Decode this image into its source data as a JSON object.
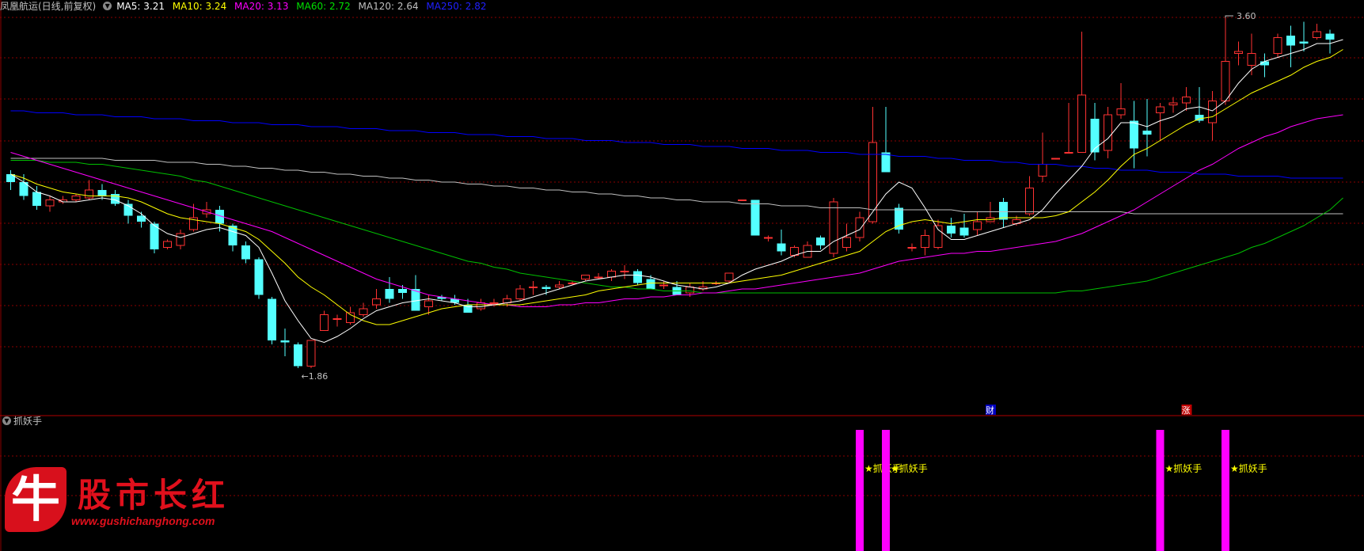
{
  "header": {
    "stock_name": "凤凰航运(日线,前复权)",
    "ma": [
      {
        "label": "MA5: 3.21",
        "color": "#ffffff"
      },
      {
        "label": "MA10: 3.24",
        "color": "#ffff00"
      },
      {
        "label": "MA20: 3.13",
        "color": "#ff00ff"
      },
      {
        "label": "MA60: 2.72",
        "color": "#00e000"
      },
      {
        "label": "MA120: 2.64",
        "color": "#c0c0c0"
      },
      {
        "label": "MA250: 2.82",
        "color": "#0000ff"
      }
    ]
  },
  "indicator": {
    "name": "抓妖手",
    "signal_label": "★抓妖手"
  },
  "watermark": {
    "title": "股市长红",
    "url": "www.gushichanghong.com",
    "badge": "牛"
  },
  "colors": {
    "up": "#ff3232",
    "down": "#54ffff",
    "grid": "#8b0000",
    "signal": "#ff00ff",
    "signal_text": "#ffff00"
  },
  "chart_data": {
    "type": "candlestick",
    "price_range": [
      1.7,
      3.7
    ],
    "annotations": {
      "low": "1.86",
      "high": "3.60",
      "marker_cai": "财",
      "marker_zhang": "涨"
    },
    "candles": [
      [
        2.84,
        2.8,
        2.86,
        2.76
      ],
      [
        2.8,
        2.73,
        2.84,
        2.71
      ],
      [
        2.75,
        2.68,
        2.78,
        2.66
      ],
      [
        2.68,
        2.71,
        2.73,
        2.65
      ],
      [
        2.7,
        2.71,
        2.73,
        2.69
      ],
      [
        2.71,
        2.73,
        2.74,
        2.7
      ],
      [
        2.72,
        2.76,
        2.81,
        2.71
      ],
      [
        2.76,
        2.73,
        2.79,
        2.71
      ],
      [
        2.74,
        2.69,
        2.76,
        2.68
      ],
      [
        2.69,
        2.63,
        2.71,
        2.59
      ],
      [
        2.63,
        2.6,
        2.65,
        2.57
      ],
      [
        2.59,
        2.46,
        2.6,
        2.44
      ],
      [
        2.47,
        2.5,
        2.51,
        2.46
      ],
      [
        2.48,
        2.54,
        2.56,
        2.46
      ],
      [
        2.56,
        2.62,
        2.69,
        2.55
      ],
      [
        2.64,
        2.66,
        2.7,
        2.62
      ],
      [
        2.66,
        2.59,
        2.68,
        2.55
      ],
      [
        2.58,
        2.48,
        2.59,
        2.45
      ],
      [
        2.48,
        2.41,
        2.5,
        2.39
      ],
      [
        2.41,
        2.23,
        2.42,
        2.21
      ],
      [
        2.21,
        2.0,
        2.22,
        1.98
      ],
      [
        2.0,
        1.99,
        2.06,
        1.92
      ],
      [
        1.98,
        1.87,
        1.99,
        1.86
      ],
      [
        1.87,
        2.0,
        2.0,
        1.86
      ],
      [
        2.05,
        2.13,
        2.15,
        2.05
      ],
      [
        2.11,
        2.11,
        2.13,
        2.07
      ],
      [
        2.09,
        2.14,
        2.17,
        2.08
      ],
      [
        2.13,
        2.16,
        2.19,
        2.12
      ],
      [
        2.18,
        2.21,
        2.26,
        2.16
      ],
      [
        2.26,
        2.21,
        2.32,
        2.19
      ],
      [
        2.26,
        2.24,
        2.28,
        2.21
      ],
      [
        2.26,
        2.15,
        2.33,
        2.15
      ],
      [
        2.17,
        2.2,
        2.23,
        2.13
      ],
      [
        2.22,
        2.21,
        2.23,
        2.2
      ],
      [
        2.21,
        2.19,
        2.23,
        2.18
      ],
      [
        2.18,
        2.14,
        2.21,
        2.14
      ],
      [
        2.16,
        2.19,
        2.21,
        2.15
      ],
      [
        2.19,
        2.19,
        2.21,
        2.17
      ],
      [
        2.19,
        2.21,
        2.23,
        2.17
      ],
      [
        2.21,
        2.26,
        2.28,
        2.2
      ],
      [
        2.27,
        2.27,
        2.3,
        2.23
      ],
      [
        2.27,
        2.26,
        2.28,
        2.23
      ],
      [
        2.27,
        2.28,
        2.3,
        2.26
      ],
      [
        2.29,
        2.29,
        2.3,
        2.28
      ],
      [
        2.31,
        2.33,
        2.33,
        2.3
      ],
      [
        2.32,
        2.32,
        2.34,
        2.31
      ],
      [
        2.32,
        2.35,
        2.36,
        2.3
      ],
      [
        2.35,
        2.35,
        2.38,
        2.31
      ],
      [
        2.35,
        2.29,
        2.36,
        2.28
      ],
      [
        2.31,
        2.26,
        2.33,
        2.26
      ],
      [
        2.28,
        2.28,
        2.3,
        2.26
      ],
      [
        2.27,
        2.23,
        2.3,
        2.23
      ],
      [
        2.24,
        2.27,
        2.29,
        2.22
      ],
      [
        2.26,
        2.27,
        2.3,
        2.25
      ],
      [
        2.29,
        2.29,
        2.3,
        2.28
      ],
      [
        2.3,
        2.34,
        2.34,
        2.29
      ],
      [
        2.71,
        2.71,
        2.71,
        2.71
      ],
      [
        2.71,
        2.53,
        2.71,
        2.53
      ],
      [
        2.52,
        2.52,
        2.53,
        2.5
      ],
      [
        2.49,
        2.45,
        2.56,
        2.43
      ],
      [
        2.43,
        2.47,
        2.48,
        2.42
      ],
      [
        2.42,
        2.48,
        2.5,
        2.42
      ],
      [
        2.52,
        2.48,
        2.53,
        2.46
      ],
      [
        2.44,
        2.7,
        2.72,
        2.42
      ],
      [
        2.47,
        2.52,
        2.59,
        2.45
      ],
      [
        2.52,
        2.62,
        2.65,
        2.5
      ],
      [
        2.6,
        3.0,
        3.18,
        2.59
      ],
      [
        2.95,
        2.85,
        3.18,
        2.85
      ],
      [
        2.67,
        2.56,
        2.69,
        2.54
      ],
      [
        2.47,
        2.47,
        2.49,
        2.45
      ],
      [
        2.47,
        2.53,
        2.56,
        2.43
      ],
      [
        2.47,
        2.58,
        2.61,
        2.46
      ],
      [
        2.58,
        2.54,
        2.62,
        2.52
      ],
      [
        2.57,
        2.53,
        2.64,
        2.52
      ],
      [
        2.56,
        2.6,
        2.65,
        2.53
      ],
      [
        2.6,
        2.62,
        2.7,
        2.6
      ],
      [
        2.7,
        2.61,
        2.72,
        2.57
      ],
      [
        2.59,
        2.61,
        2.63,
        2.58
      ],
      [
        2.64,
        2.77,
        2.83,
        2.63
      ],
      [
        2.83,
        2.89,
        3.05,
        2.8
      ],
      [
        2.92,
        2.92,
        2.92,
        2.92
      ],
      [
        2.95,
        2.95,
        3.2,
        2.95
      ],
      [
        2.95,
        3.24,
        3.56,
        2.95
      ],
      [
        3.12,
        2.95,
        3.2,
        2.91
      ],
      [
        2.96,
        3.14,
        3.18,
        2.92
      ],
      [
        3.14,
        3.17,
        3.3,
        3.12
      ],
      [
        3.11,
        2.97,
        3.21,
        2.87
      ],
      [
        3.06,
        3.04,
        3.22,
        2.93
      ],
      [
        3.15,
        3.18,
        3.2,
        3.01
      ],
      [
        3.19,
        3.2,
        3.23,
        3.15
      ],
      [
        3.2,
        3.23,
        3.28,
        3.16
      ],
      [
        3.14,
        3.11,
        3.28,
        3.1
      ],
      [
        3.1,
        3.21,
        3.26,
        3.01
      ],
      [
        3.21,
        3.41,
        3.63,
        3.19
      ],
      [
        3.45,
        3.46,
        3.51,
        3.39
      ],
      [
        3.39,
        3.45,
        3.55,
        3.34
      ],
      [
        3.41,
        3.39,
        3.45,
        3.33
      ],
      [
        3.45,
        3.53,
        3.55,
        3.43
      ],
      [
        3.54,
        3.49,
        3.59,
        3.38
      ],
      [
        3.51,
        3.5,
        3.61,
        3.46
      ],
      [
        3.53,
        3.56,
        3.6,
        3.52
      ],
      [
        3.55,
        3.52,
        3.57,
        3.45
      ]
    ],
    "ma5": [
      2.84,
      2.8,
      2.75,
      2.73,
      2.7,
      2.7,
      2.71,
      2.72,
      2.71,
      2.68,
      2.64,
      2.58,
      2.54,
      2.52,
      2.54,
      2.56,
      2.57,
      2.55,
      2.53,
      2.47,
      2.34,
      2.2,
      2.1,
      2.01,
      1.99,
      2.02,
      2.06,
      2.11,
      2.15,
      2.17,
      2.19,
      2.2,
      2.21,
      2.2,
      2.19,
      2.17,
      2.17,
      2.18,
      2.19,
      2.2,
      2.22,
      2.24,
      2.26,
      2.28,
      2.3,
      2.31,
      2.32,
      2.33,
      2.33,
      2.32,
      2.3,
      2.28,
      2.27,
      2.26,
      2.27,
      2.29,
      2.33,
      2.36,
      2.38,
      2.4,
      2.43,
      2.45,
      2.45,
      2.5,
      2.53,
      2.56,
      2.65,
      2.74,
      2.8,
      2.77,
      2.67,
      2.56,
      2.51,
      2.51,
      2.53,
      2.55,
      2.57,
      2.59,
      2.61,
      2.66,
      2.74,
      2.81,
      2.88,
      2.97,
      3.02,
      3.1,
      3.1,
      3.08,
      3.11,
      3.13,
      3.17,
      3.18,
      3.16,
      3.21,
      3.3,
      3.37,
      3.41,
      3.43,
      3.45,
      3.47,
      3.5,
      3.5,
      3.52
    ],
    "ma10": [
      2.84,
      2.82,
      2.79,
      2.77,
      2.75,
      2.74,
      2.73,
      2.73,
      2.73,
      2.72,
      2.7,
      2.67,
      2.64,
      2.62,
      2.61,
      2.6,
      2.59,
      2.57,
      2.55,
      2.51,
      2.45,
      2.39,
      2.32,
      2.27,
      2.23,
      2.18,
      2.13,
      2.1,
      2.08,
      2.08,
      2.1,
      2.12,
      2.14,
      2.16,
      2.17,
      2.18,
      2.18,
      2.18,
      2.18,
      2.18,
      2.19,
      2.2,
      2.21,
      2.22,
      2.23,
      2.25,
      2.26,
      2.27,
      2.28,
      2.29,
      2.29,
      2.29,
      2.29,
      2.29,
      2.29,
      2.29,
      2.3,
      2.31,
      2.32,
      2.33,
      2.35,
      2.37,
      2.39,
      2.41,
      2.43,
      2.45,
      2.5,
      2.55,
      2.58,
      2.6,
      2.61,
      2.6,
      2.59,
      2.6,
      2.61,
      2.61,
      2.62,
      2.62,
      2.62,
      2.62,
      2.63,
      2.65,
      2.7,
      2.75,
      2.81,
      2.88,
      2.94,
      2.97,
      3.01,
      3.05,
      3.09,
      3.12,
      3.13,
      3.17,
      3.21,
      3.25,
      3.28,
      3.31,
      3.34,
      3.38,
      3.41,
      3.43,
      3.47
    ],
    "ma20": [
      2.95,
      2.93,
      2.91,
      2.89,
      2.87,
      2.85,
      2.83,
      2.81,
      2.79,
      2.77,
      2.75,
      2.73,
      2.71,
      2.69,
      2.67,
      2.65,
      2.63,
      2.61,
      2.59,
      2.57,
      2.55,
      2.52,
      2.49,
      2.46,
      2.43,
      2.4,
      2.37,
      2.34,
      2.31,
      2.29,
      2.27,
      2.25,
      2.23,
      2.22,
      2.21,
      2.2,
      2.19,
      2.18,
      2.18,
      2.17,
      2.17,
      2.17,
      2.18,
      2.18,
      2.19,
      2.19,
      2.2,
      2.21,
      2.21,
      2.22,
      2.22,
      2.23,
      2.23,
      2.24,
      2.24,
      2.25,
      2.26,
      2.26,
      2.27,
      2.28,
      2.29,
      2.3,
      2.31,
      2.32,
      2.33,
      2.34,
      2.36,
      2.38,
      2.4,
      2.41,
      2.42,
      2.43,
      2.44,
      2.44,
      2.45,
      2.45,
      2.46,
      2.47,
      2.48,
      2.49,
      2.5,
      2.52,
      2.54,
      2.57,
      2.6,
      2.63,
      2.66,
      2.7,
      2.74,
      2.78,
      2.82,
      2.86,
      2.89,
      2.93,
      2.97,
      3.0,
      3.03,
      3.05,
      3.08,
      3.1,
      3.12,
      3.13,
      3.14
    ],
    "ma60": [
      2.91,
      2.91,
      2.91,
      2.9,
      2.9,
      2.9,
      2.89,
      2.89,
      2.88,
      2.87,
      2.86,
      2.85,
      2.84,
      2.83,
      2.81,
      2.8,
      2.78,
      2.76,
      2.74,
      2.72,
      2.7,
      2.68,
      2.66,
      2.64,
      2.62,
      2.6,
      2.58,
      2.56,
      2.54,
      2.52,
      2.5,
      2.48,
      2.46,
      2.44,
      2.42,
      2.4,
      2.39,
      2.37,
      2.36,
      2.34,
      2.33,
      2.32,
      2.31,
      2.3,
      2.29,
      2.28,
      2.27,
      2.27,
      2.26,
      2.26,
      2.25,
      2.25,
      2.25,
      2.24,
      2.24,
      2.24,
      2.24,
      2.24,
      2.24,
      2.24,
      2.24,
      2.24,
      2.24,
      2.24,
      2.24,
      2.24,
      2.24,
      2.24,
      2.24,
      2.24,
      2.24,
      2.24,
      2.24,
      2.24,
      2.24,
      2.24,
      2.24,
      2.24,
      2.24,
      2.24,
      2.24,
      2.25,
      2.25,
      2.26,
      2.27,
      2.28,
      2.29,
      2.3,
      2.32,
      2.34,
      2.36,
      2.38,
      2.4,
      2.42,
      2.44,
      2.47,
      2.49,
      2.52,
      2.55,
      2.58,
      2.62,
      2.66,
      2.72
    ],
    "ma120": [
      2.92,
      2.92,
      2.92,
      2.92,
      2.92,
      2.92,
      2.92,
      2.92,
      2.91,
      2.91,
      2.91,
      2.91,
      2.9,
      2.9,
      2.9,
      2.89,
      2.89,
      2.88,
      2.88,
      2.87,
      2.87,
      2.86,
      2.86,
      2.85,
      2.85,
      2.84,
      2.84,
      2.83,
      2.83,
      2.82,
      2.82,
      2.81,
      2.81,
      2.8,
      2.8,
      2.79,
      2.79,
      2.78,
      2.78,
      2.77,
      2.77,
      2.76,
      2.76,
      2.75,
      2.75,
      2.74,
      2.74,
      2.73,
      2.73,
      2.72,
      2.72,
      2.71,
      2.71,
      2.7,
      2.7,
      2.7,
      2.69,
      2.69,
      2.69,
      2.68,
      2.68,
      2.68,
      2.67,
      2.67,
      2.67,
      2.67,
      2.66,
      2.66,
      2.66,
      2.66,
      2.66,
      2.66,
      2.66,
      2.65,
      2.65,
      2.65,
      2.65,
      2.65,
      2.65,
      2.65,
      2.65,
      2.65,
      2.65,
      2.65,
      2.65,
      2.65,
      2.64,
      2.64,
      2.64,
      2.64,
      2.64,
      2.64,
      2.64,
      2.64,
      2.64,
      2.64,
      2.64,
      2.64,
      2.64,
      2.64,
      2.64,
      2.64,
      2.64
    ],
    "ma250": [
      3.16,
      3.16,
      3.15,
      3.15,
      3.15,
      3.14,
      3.14,
      3.14,
      3.13,
      3.13,
      3.13,
      3.12,
      3.12,
      3.12,
      3.11,
      3.11,
      3.11,
      3.1,
      3.1,
      3.1,
      3.09,
      3.09,
      3.09,
      3.08,
      3.08,
      3.08,
      3.07,
      3.07,
      3.07,
      3.06,
      3.06,
      3.06,
      3.05,
      3.05,
      3.05,
      3.04,
      3.04,
      3.04,
      3.03,
      3.03,
      3.03,
      3.02,
      3.02,
      3.02,
      3.01,
      3.01,
      3.01,
      3.0,
      3.0,
      3.0,
      2.99,
      2.99,
      2.99,
      2.98,
      2.98,
      2.98,
      2.97,
      2.97,
      2.97,
      2.96,
      2.96,
      2.96,
      2.95,
      2.95,
      2.95,
      2.94,
      2.94,
      2.94,
      2.93,
      2.93,
      2.93,
      2.92,
      2.92,
      2.91,
      2.91,
      2.91,
      2.9,
      2.9,
      2.89,
      2.89,
      2.89,
      2.88,
      2.88,
      2.87,
      2.87,
      2.86,
      2.86,
      2.86,
      2.85,
      2.85,
      2.85,
      2.84,
      2.84,
      2.84,
      2.83,
      2.83,
      2.83,
      2.83,
      2.82,
      2.82,
      2.82,
      2.82,
      2.82
    ],
    "signal_bars": [
      {
        "index": 65,
        "labeled": true
      },
      {
        "index": 67,
        "labeled": true
      },
      {
        "index": 88,
        "labeled": true
      },
      {
        "index": 93,
        "labeled": true
      }
    ]
  }
}
